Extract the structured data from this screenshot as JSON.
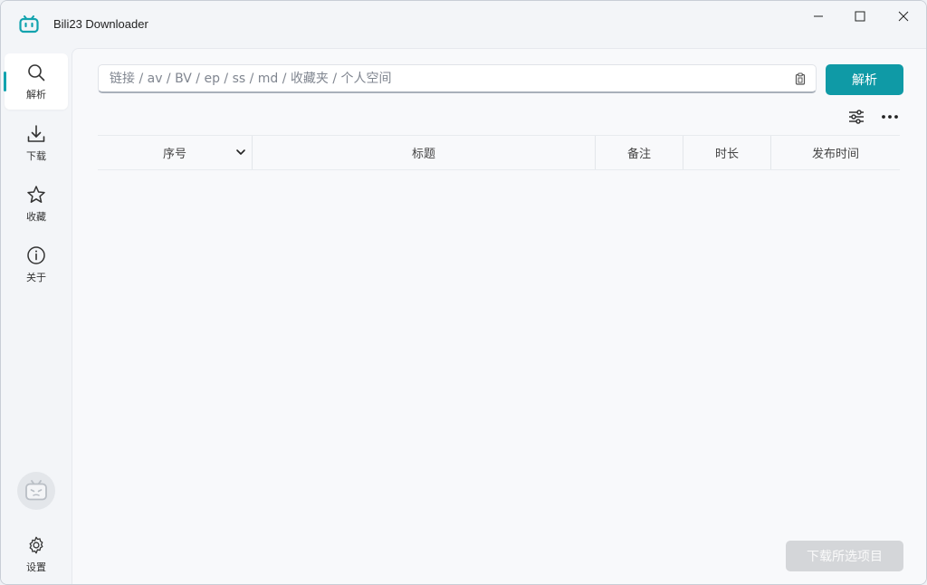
{
  "window": {
    "title": "Bili23 Downloader",
    "accent_color": "#0f9aa6"
  },
  "sidebar": {
    "items": [
      {
        "label": "解析",
        "icon": "search-icon",
        "active": true
      },
      {
        "label": "下载",
        "icon": "download-icon",
        "active": false
      },
      {
        "label": "收藏",
        "icon": "star-icon",
        "active": false
      },
      {
        "label": "关于",
        "icon": "info-icon",
        "active": false
      }
    ],
    "avatar_icon": "bilibili-tv-avatar-icon",
    "settings": {
      "label": "设置",
      "icon": "gear-icon"
    }
  },
  "search": {
    "placeholder": "链接 / av / BV / ep / ss / md / 收藏夹 / 个人空间",
    "value": "",
    "paste_icon": "clipboard-icon",
    "parse_label": "解析"
  },
  "toolbar": {
    "icons": [
      "tune-icon",
      "more-icon"
    ]
  },
  "table": {
    "columns": [
      "序号",
      "标题",
      "备注",
      "时长",
      "发布时间"
    ],
    "rows": []
  },
  "footer": {
    "download_label": "下载所选项目",
    "download_enabled": false
  }
}
